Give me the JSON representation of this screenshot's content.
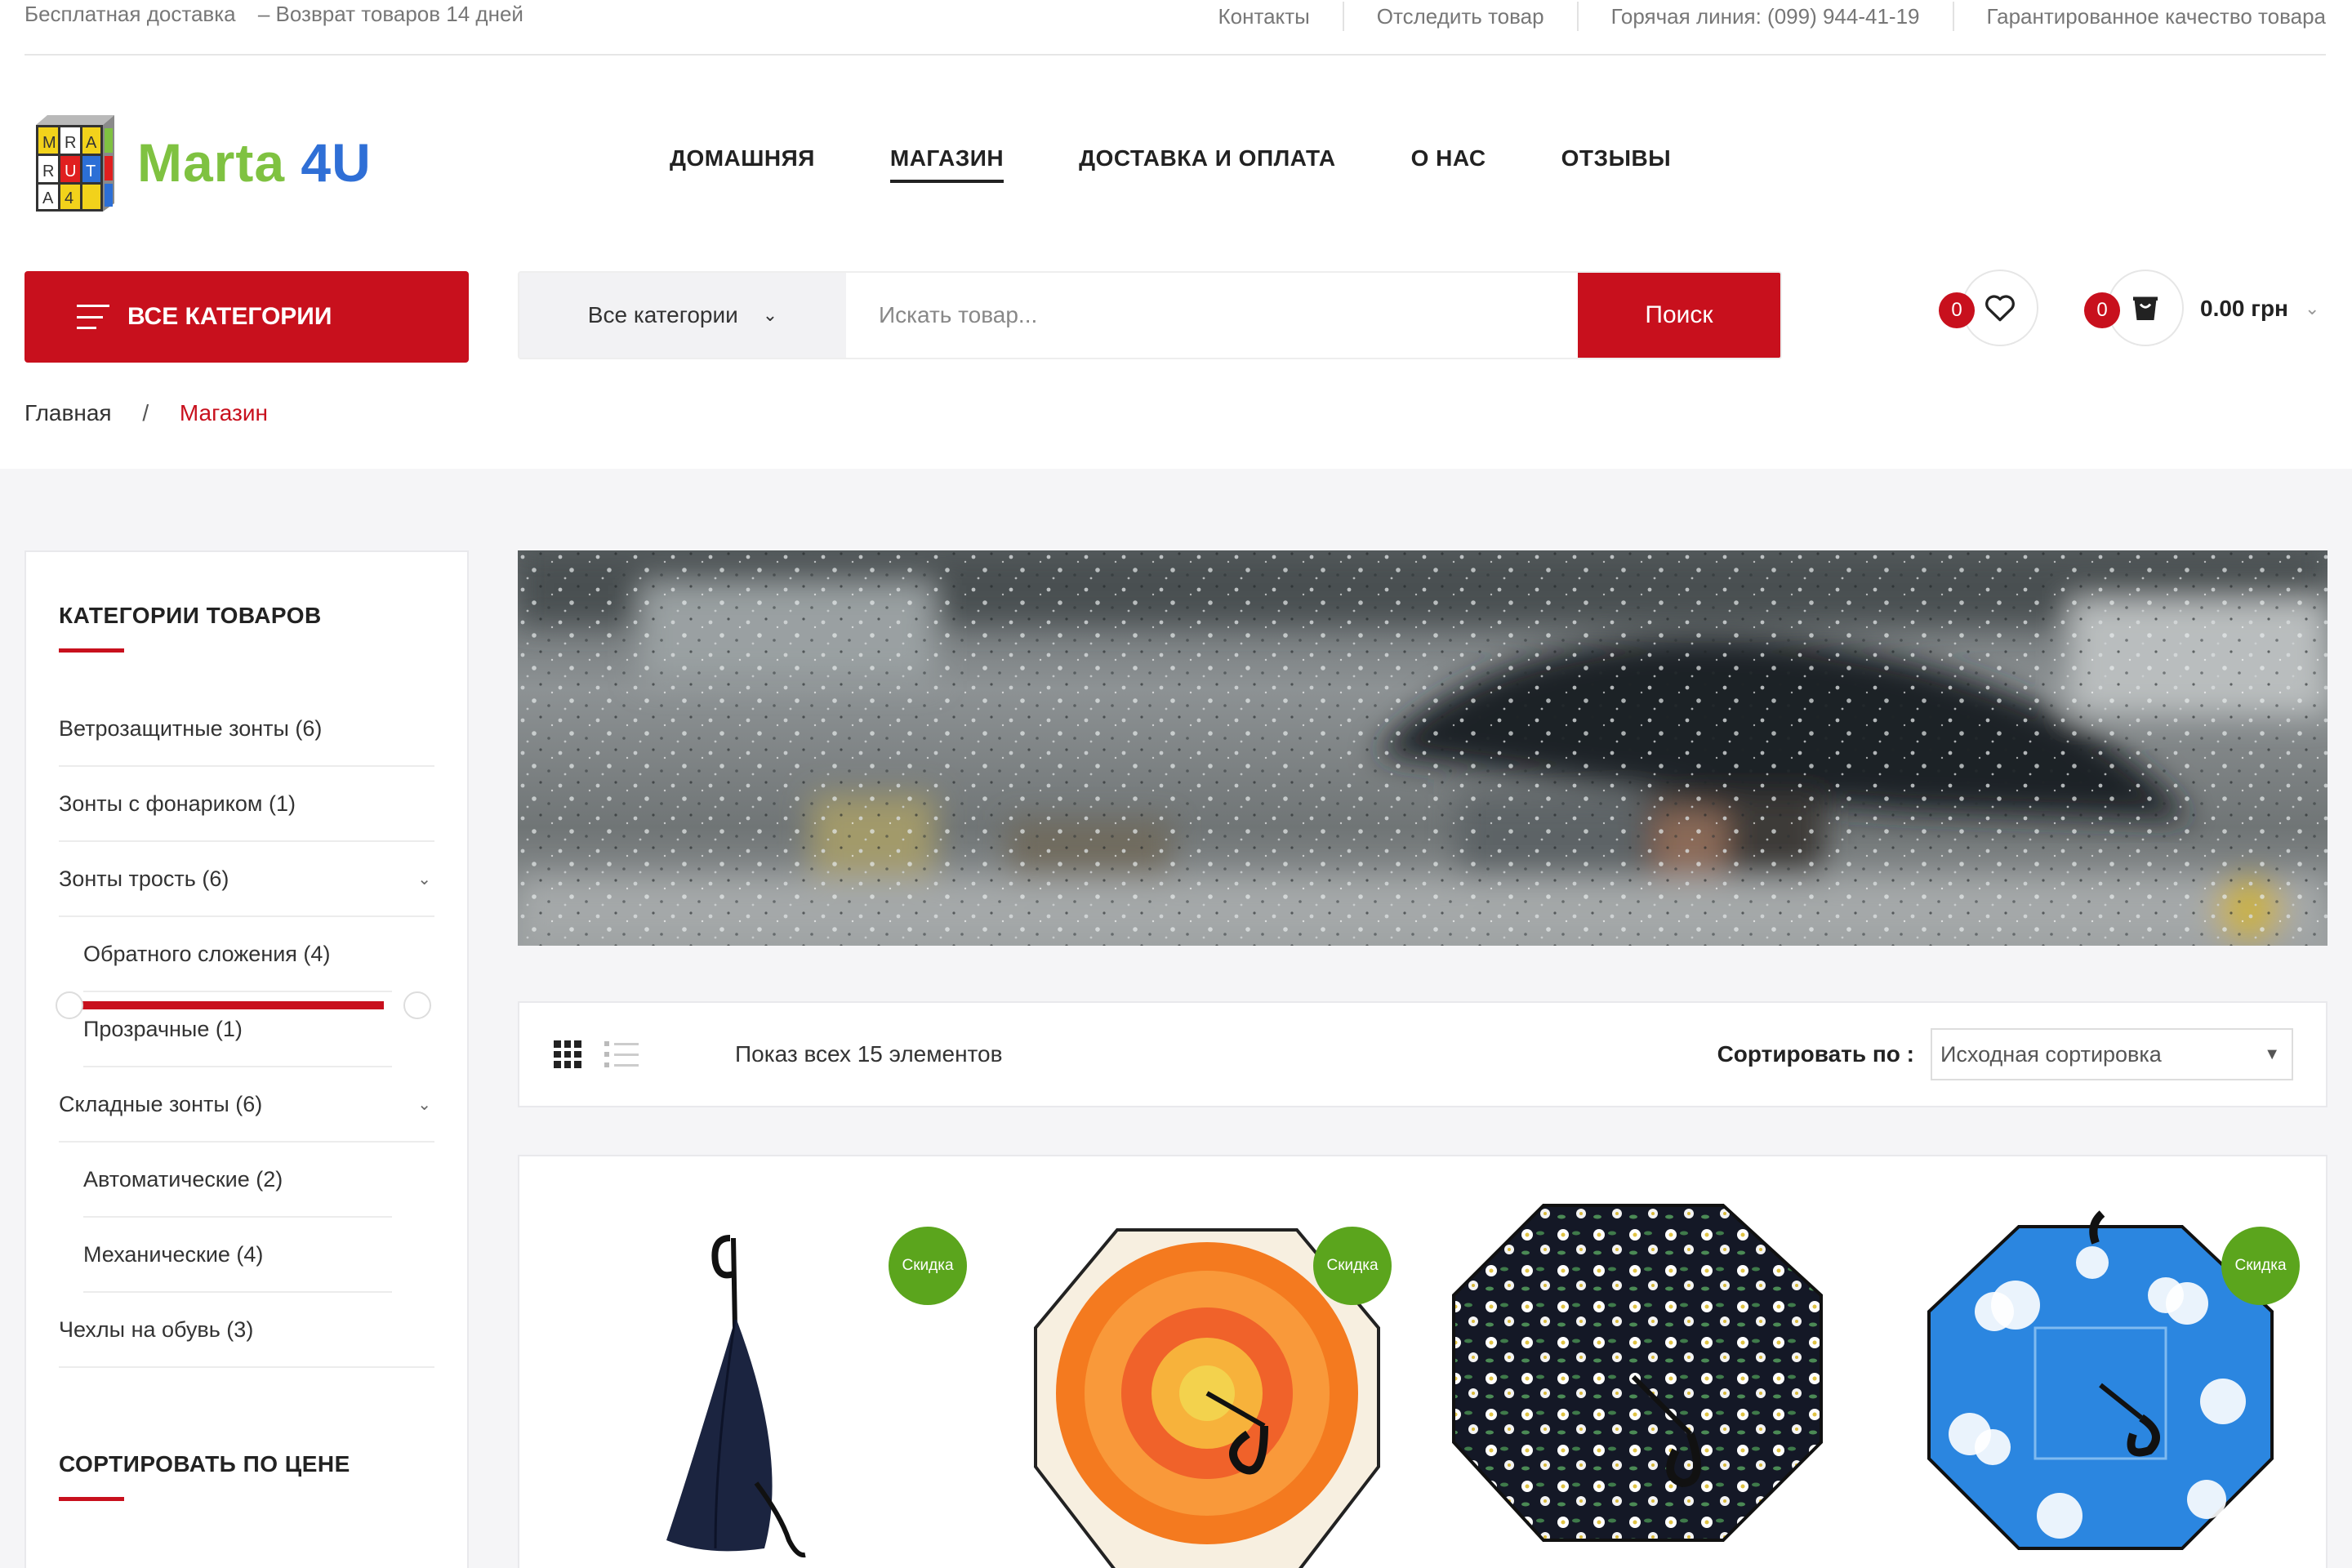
{
  "topbar": {
    "left_items": [
      "Бесплатная доставка",
      "– Возврат товаров 14 дней"
    ],
    "links": [
      "Контакты",
      "Отследить товар",
      "Горячая линия: (099) 944-41-19",
      "Гарантированное качество товара"
    ]
  },
  "logo": {
    "text": "Marta 4U",
    "cube_letters": [
      "M",
      "R",
      "A",
      "R",
      "U",
      "T",
      "A",
      "4",
      ""
    ],
    "colors": {
      "marta": "#7fc241",
      "four_u": "#2f6fd6"
    }
  },
  "nav": {
    "items": [
      {
        "label": "ДОМАШНЯЯ",
        "active": false
      },
      {
        "label": "МАГАЗИН",
        "active": true
      },
      {
        "label": "ДОСТАВКА И ОПЛАТА",
        "active": false
      },
      {
        "label": "О НАС",
        "active": false
      },
      {
        "label": "ОТЗЫВЫ",
        "active": false
      }
    ]
  },
  "all_categories_button": "ВСЕ КАТЕГОРИИ",
  "search": {
    "category_value": "Все категории",
    "placeholder": "Искать товар...",
    "button": "Поиск"
  },
  "wishlist": {
    "count": "0",
    "icon": "heart-icon"
  },
  "cart": {
    "count": "0",
    "total": "0.00 грн",
    "icon": "shopping-bag-icon"
  },
  "breadcrumb": {
    "home": "Главная",
    "separator": "/",
    "current": "Магазин"
  },
  "sidebar": {
    "categories_title": "КАТЕГОРИИ ТОВАРОВ",
    "categories": [
      {
        "label": "Ветрозащитные зонты (6)",
        "sub": false,
        "expandable": false
      },
      {
        "label": "Зонты с фонариком (1)",
        "sub": false,
        "expandable": false
      },
      {
        "label": "Зонты трость (6)",
        "sub": false,
        "expandable": true
      },
      {
        "label": "Обратного сложения (4)",
        "sub": true,
        "expandable": false
      },
      {
        "label": "Прозрачные (1)",
        "sub": true,
        "expandable": false
      },
      {
        "label": "Складные зонты (6)",
        "sub": false,
        "expandable": true
      },
      {
        "label": "Автоматические (2)",
        "sub": true,
        "expandable": false
      },
      {
        "label": "Механические (4)",
        "sub": true,
        "expandable": false
      },
      {
        "label": "Чехлы на обувь (3)",
        "sub": false,
        "expandable": false
      }
    ],
    "price_title": "СОРТИРОВАТЬ ПО ЦЕНЕ"
  },
  "toolbar": {
    "showing": "Показ всех 15 элементов",
    "sort_label": "Сортировать по :",
    "sort_value": "Исходная сортировка"
  },
  "products": [
    {
      "sale": true,
      "sale_label": "Скидка",
      "image": "closed-navy-umbrella"
    },
    {
      "sale": true,
      "sale_label": "Скидка",
      "image": "orange-flower-umbrella"
    },
    {
      "sale": false,
      "sale_label": "",
      "image": "daisy-print-umbrella"
    },
    {
      "sale": true,
      "sale_label": "Скидка",
      "image": "sky-clouds-umbrella"
    }
  ],
  "colors": {
    "accent": "#c8101d",
    "sale": "#5ba51d",
    "page_bg": "#f5f5f7"
  }
}
